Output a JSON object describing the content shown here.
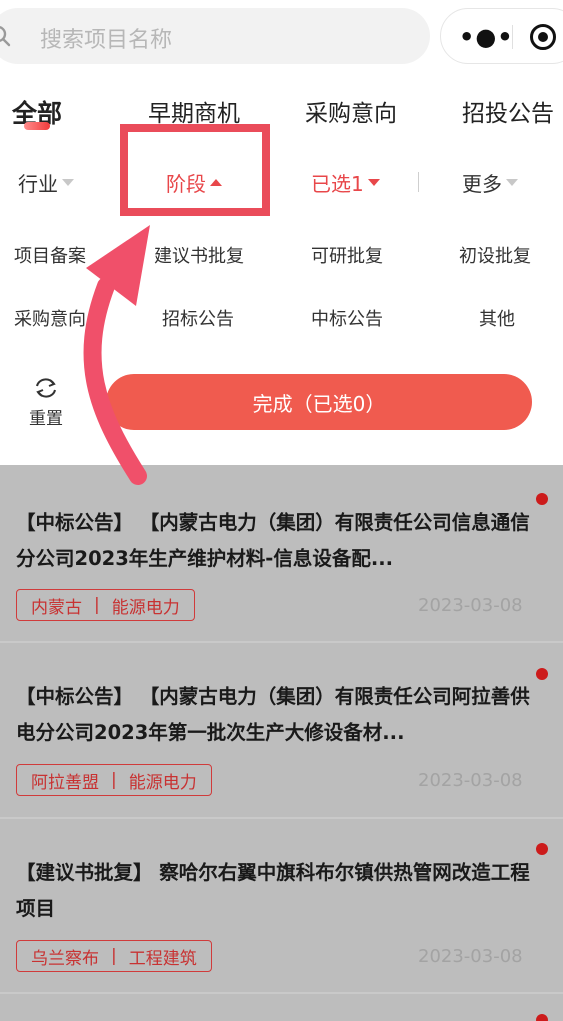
{
  "search": {
    "placeholder": "搜索项目名称"
  },
  "capsule": {
    "more_icon": "more-dots-icon",
    "target_icon": "target-icon"
  },
  "tabs": [
    {
      "label": "全部",
      "active": true
    },
    {
      "label": "早期商机",
      "active": false
    },
    {
      "label": "采购意向",
      "active": false
    },
    {
      "label": "招投公告",
      "active": false
    }
  ],
  "filters": {
    "industry": "行业",
    "stage": "阶段",
    "selected": "已选1",
    "more": "更多"
  },
  "stage_options": [
    "项目备案",
    "建议书批复",
    "可研批复",
    "初设批复",
    "采购意向",
    "招标公告",
    "中标公告",
    "其他"
  ],
  "actions": {
    "reset_label": "重置",
    "done_label": "完成（已选0）"
  },
  "results": [
    {
      "title": "【中标公告】 【内蒙古电力（集团）有限责任公司信息通信分公司2023年生产维护材料-信息设备配...",
      "tag_region": "内蒙古",
      "tag_industry": "能源电力",
      "date": "2023-03-08",
      "unread": true
    },
    {
      "title": "【中标公告】 【内蒙古电力（集团）有限责任公司阿拉善供电分公司2023年第一批次生产大修设备材...",
      "tag_region": "阿拉善盟",
      "tag_industry": "能源电力",
      "date": "2023-03-08",
      "unread": true
    },
    {
      "title": "【建议书批复】 察哈尔右翼中旗科布尔镇供热管网改造工程项目",
      "tag_region": "乌兰察布",
      "tag_industry": "工程建筑",
      "date": "2023-03-08",
      "unread": true
    }
  ],
  "colors": {
    "accent": "#f05b4f",
    "active_filter": "#e8474a",
    "annotation": "#ea4c5a",
    "overlay": "#bdbdbd"
  }
}
